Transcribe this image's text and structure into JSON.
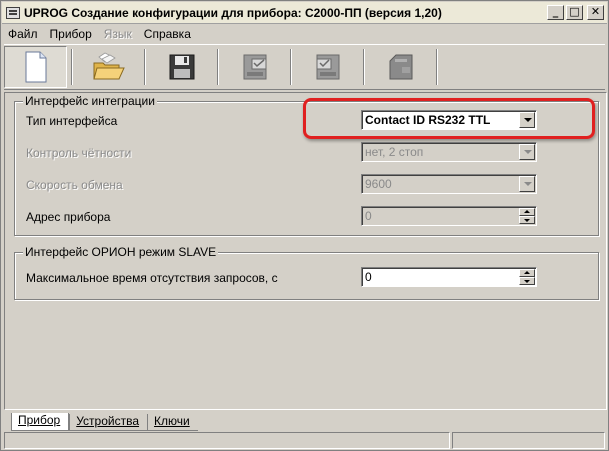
{
  "window": {
    "title": "UPROG  Создание конфигурации для прибора: С2000-ПП (версия  1,20)",
    "minimize_glyph": "_",
    "maximize_glyph": "□",
    "close_glyph": "✕"
  },
  "menu": {
    "items": [
      {
        "label": "Файл",
        "enabled": true
      },
      {
        "label": "Прибор",
        "enabled": true
      },
      {
        "label": "Язык",
        "enabled": false
      },
      {
        "label": "Справка",
        "enabled": true
      }
    ]
  },
  "toolbar": {
    "buttons": [
      {
        "icon": "new-document-icon",
        "enabled": true
      },
      {
        "icon": "open-folder-icon",
        "enabled": true
      },
      {
        "icon": "save-disk-icon",
        "enabled": true
      },
      {
        "icon": "read-from-device-icon",
        "enabled": false
      },
      {
        "icon": "write-to-device-icon",
        "enabled": false
      },
      {
        "icon": "device-icon",
        "enabled": false
      }
    ]
  },
  "integration_group": {
    "legend": "Интерфейс интеграции",
    "interface_type": {
      "label": "Тип интерфейса",
      "value": "Contact ID RS232 TTL"
    },
    "parity": {
      "label": "Контроль чётности",
      "value": "нет, 2 стоп"
    },
    "baud_rate": {
      "label": "Скорость обмена",
      "value": "9600"
    },
    "device_address": {
      "label": "Адрес прибора",
      "value": "0"
    }
  },
  "orion_group": {
    "legend": "Интерфейс ОРИОН режим SLAVE",
    "max_time": {
      "label": "Максимальное время отсутствия запросов, с",
      "value": "0"
    }
  },
  "tabs": [
    {
      "label": "Прибор",
      "active": true
    },
    {
      "label": "Устройства",
      "active": false
    },
    {
      "label": "Ключи",
      "active": false
    }
  ],
  "colors": {
    "highlight": "#e02020",
    "window_bg": "#d4d0c8"
  }
}
